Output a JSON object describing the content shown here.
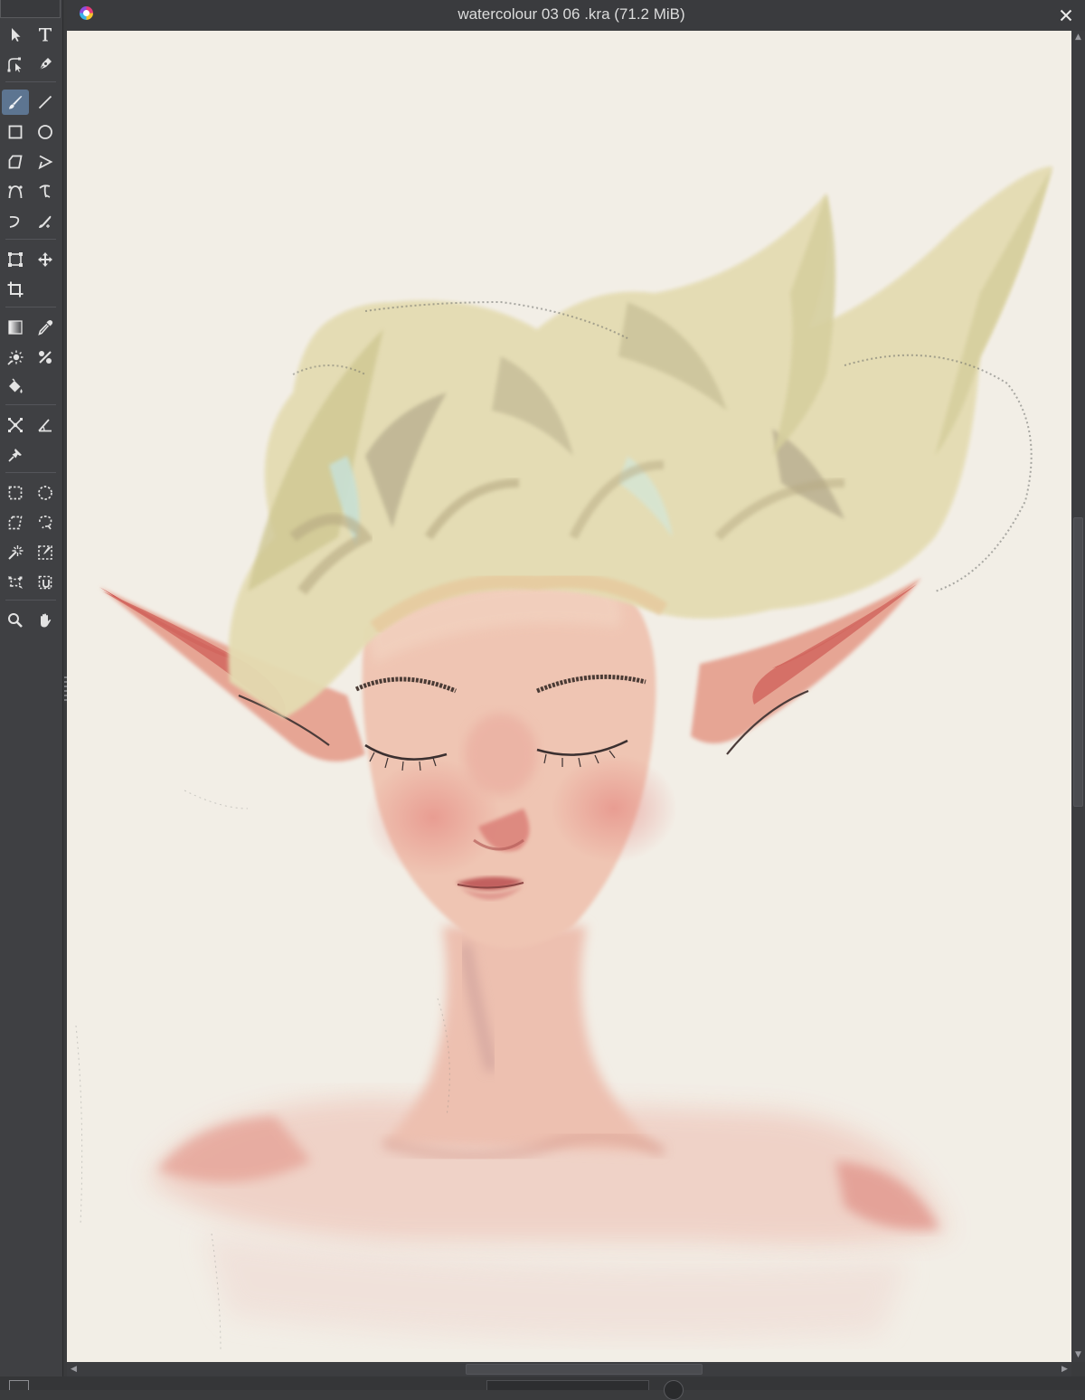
{
  "window": {
    "title": "watercolour 03 06 .kra (71.2 MiB)",
    "close_symbol": "✕"
  },
  "toolbox": {
    "active_tool": "freehand-brush-tool",
    "tools": [
      "select-shapes-tool",
      "text-tool",
      "edit-shapes-tool",
      "calligraphy-tool",
      "freehand-brush-tool",
      "line-tool",
      "rectangle-tool",
      "ellipse-tool",
      "polygon-tool",
      "polyline-tool",
      "bezier-curve-tool",
      "freehand-path-tool",
      "dynamic-brush-tool",
      "multibrush-tool",
      "transform-tool",
      "move-tool",
      "crop-tool",
      "gradient-tool",
      "color-sampler-tool",
      "smart-patch-tool",
      "colorize-mask-tool",
      "fill-tool",
      "assistant-tool",
      "measure-tool",
      "reference-images-tool",
      "rectangular-selection-tool",
      "elliptical-selection-tool",
      "polygonal-selection-tool",
      "freehand-selection-tool",
      "contiguous-selection-tool",
      "similar-color-selection-tool",
      "bezier-selection-tool",
      "magnetic-selection-tool",
      "zoom-tool",
      "pan-tool"
    ]
  },
  "colors": {
    "canvas": "#f2eee6",
    "active_tool_highlight": "#5d7591",
    "hair": "#d6d09b",
    "skin": "#e8b9a8",
    "ears": "#cf5e5a"
  }
}
